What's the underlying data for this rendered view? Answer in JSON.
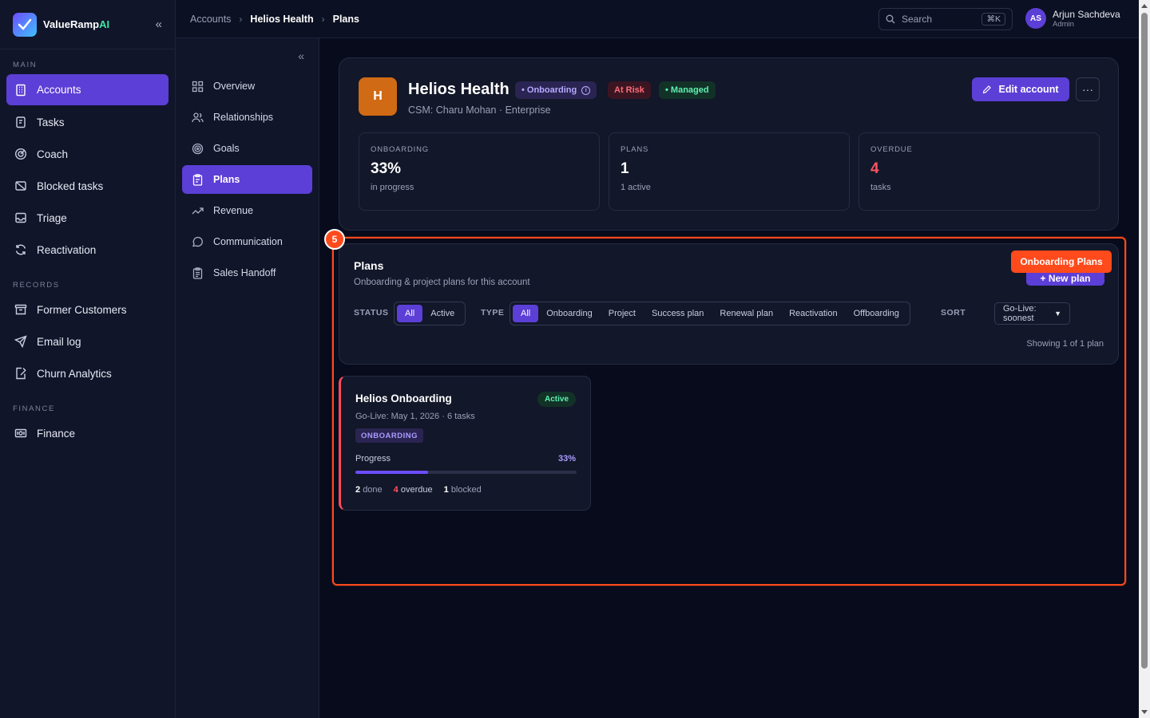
{
  "brand": {
    "name_main": "ValueRamp",
    "name_accent": "AI"
  },
  "sidebar": {
    "sections": [
      {
        "label": "MAIN",
        "items": [
          {
            "label": "Accounts",
            "icon": "building-icon",
            "active": true
          },
          {
            "label": "Tasks",
            "icon": "clipboard-icon"
          },
          {
            "label": "Coach",
            "icon": "target-icon"
          },
          {
            "label": "Blocked tasks",
            "icon": "blocked-icon"
          },
          {
            "label": "Triage",
            "icon": "inbox-icon"
          },
          {
            "label": "Reactivation",
            "icon": "refresh-icon"
          }
        ]
      },
      {
        "label": "RECORDS",
        "items": [
          {
            "label": "Former Customers",
            "icon": "archive-icon"
          },
          {
            "label": "Email log",
            "icon": "send-icon"
          },
          {
            "label": "Churn Analytics",
            "icon": "chart-icon"
          }
        ]
      },
      {
        "label": "FINANCE",
        "items": [
          {
            "label": "Finance",
            "icon": "banknote-icon"
          }
        ]
      }
    ]
  },
  "subnav": {
    "items": [
      {
        "label": "Overview",
        "icon": "grid-icon"
      },
      {
        "label": "Relationships",
        "icon": "users-icon"
      },
      {
        "label": "Goals",
        "icon": "target-icon"
      },
      {
        "label": "Plans",
        "icon": "clipboard-icon",
        "active": true
      },
      {
        "label": "Revenue",
        "icon": "trend-icon"
      },
      {
        "label": "Communication",
        "icon": "chat-icon"
      },
      {
        "label": "Sales Handoff",
        "icon": "clipboard-list-icon"
      }
    ]
  },
  "breadcrumb": [
    "Accounts",
    "Helios Health",
    "Plans"
  ],
  "search": {
    "placeholder": "Search",
    "shortcut": "⌘K"
  },
  "user": {
    "initials": "AS",
    "name": "Arjun Sachdeva",
    "role": "Admin"
  },
  "account": {
    "initial": "H",
    "name": "Helios Health",
    "badges": {
      "stage": "• Onboarding",
      "risk": "At Risk",
      "managed": "• Managed"
    },
    "subtitle": "CSM: Charu Mohan · Enterprise",
    "edit_label": "Edit account",
    "more_label": "···",
    "stats": [
      {
        "label": "ONBOARDING",
        "value": "33%",
        "note": "in progress"
      },
      {
        "label": "PLANS",
        "value": "1",
        "note": "1 active"
      },
      {
        "label": "OVERDUE",
        "value": "4",
        "note": "tasks"
      }
    ]
  },
  "highlight": {
    "number": "5",
    "label": "Onboarding Plans",
    "color": "#ff4a1c"
  },
  "plans": {
    "title": "Plans",
    "subtitle": "Onboarding & project plans for this account",
    "new_plan_label": "+ New plan",
    "status_label": "STATUS",
    "status_options": [
      "All",
      "Active"
    ],
    "type_label": "TYPE",
    "type_options": [
      "All",
      "Onboarding",
      "Project",
      "Success plan",
      "Renewal plan",
      "Reactivation",
      "Offboarding"
    ],
    "sort_label": "SORT",
    "sort_value": "Go-Live: soonest",
    "showing": "Showing 1 of 1 plan"
  },
  "plan_item": {
    "title": "Helios Onboarding",
    "status": "Active",
    "meta": "Go-Live: May 1, 2026 · 6 tasks",
    "type": "ONBOARDING",
    "progress_label": "Progress",
    "progress_text": "33%",
    "progress_value": 0.33,
    "done_count": "2",
    "done_label": "done",
    "overdue_count": "4",
    "overdue_label": "overdue",
    "blocked_count": "1",
    "blocked_label": "blocked"
  },
  "colors": {
    "accent": "#5b3fd6",
    "danger": "#ff5264",
    "success": "#5ff0b0",
    "highlight": "#ff4a1c"
  }
}
